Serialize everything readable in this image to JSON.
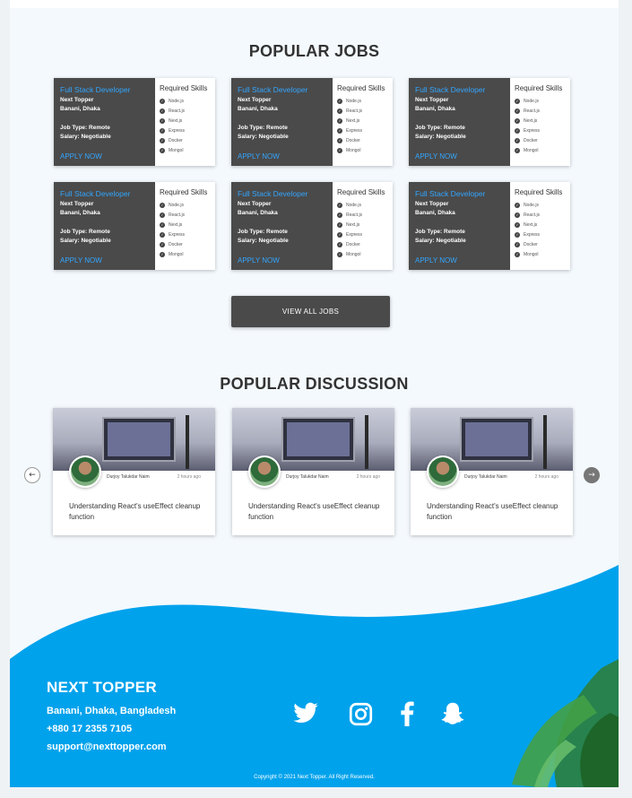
{
  "sections": {
    "jobs_title": "POPULAR JOBS",
    "discussion_title": "POPULAR DISCUSSION"
  },
  "jobs": [
    {
      "title": "Full Stack Developer",
      "company": "Next Topper",
      "location": "Banani, Dhaka",
      "type": "Job Type: Remote",
      "salary": "Salary: Negotiable",
      "apply": "APPLY NOW",
      "skills_title": "Required Skills",
      "skills": [
        "Node.js",
        "React.js",
        "Next.js",
        "Express",
        "Docker",
        "MongoI"
      ]
    },
    {
      "title": "Full Stack Developer",
      "company": "Next Topper",
      "location": "Banani, Dhaka",
      "type": "Job Type: Remote",
      "salary": "Salary: Negotiable",
      "apply": "APPLY NOW",
      "skills_title": "Required Skills",
      "skills": [
        "Node.js",
        "React.js",
        "Next.js",
        "Express",
        "Docker",
        "MongoI"
      ]
    },
    {
      "title": "Full Stack Developer",
      "company": "Next Topper",
      "location": "Banani, Dhaka",
      "type": "Job Type: Remote",
      "salary": "Salary: Negotiable",
      "apply": "APPLY NOW",
      "skills_title": "Required Skills",
      "skills": [
        "Node.js",
        "React.js",
        "Next.js",
        "Express",
        "Docker",
        "MongoI"
      ]
    },
    {
      "title": "Full Stack Developer",
      "company": "Next Topper",
      "location": "Banani, Dhaka",
      "type": "Job Type: Remote",
      "salary": "Salary: Negotiable",
      "apply": "APPLY NOW",
      "skills_title": "Required Skills",
      "skills": [
        "Node.js",
        "React.js",
        "Next.js",
        "Express",
        "Docker",
        "MongoI"
      ]
    },
    {
      "title": "Full Stack Developer",
      "company": "Next Topper",
      "location": "Banani, Dhaka",
      "type": "Job Type: Remote",
      "salary": "Salary: Negotiable",
      "apply": "APPLY NOW",
      "skills_title": "Required Skills",
      "skills": [
        "Node.js",
        "React.js",
        "Next.js",
        "Express",
        "Docker",
        "MongoI"
      ]
    },
    {
      "title": "Full Stack Developer",
      "company": "Next Topper",
      "location": "Banani, Dhaka",
      "type": "Job Type: Remote",
      "salary": "Salary: Negotiable",
      "apply": "APPLY NOW",
      "skills_title": "Required Skills",
      "skills": [
        "Node.js",
        "React.js",
        "Next.js",
        "Express",
        "Docker",
        "MongoI"
      ]
    }
  ],
  "view_all_label": "VIEW ALL JOBS",
  "discussions": [
    {
      "author": "Durjoy Talukdar Naim",
      "time": "2 hours ago",
      "title": "Understanding React's useEffect cleanup function"
    },
    {
      "author": "Durjoy Talukdar Naim",
      "time": "2 hours ago",
      "title": "Understanding React's useEffect cleanup function"
    },
    {
      "author": "Durjoy Talukdar Naim",
      "time": "2 hours ago",
      "title": "Understanding React's useEffect cleanup function"
    }
  ],
  "nav": {
    "prev_icon": "arrow-left-icon",
    "next_icon": "arrow-right-icon"
  },
  "footer": {
    "brand": "NEXT TOPPER",
    "address": "Banani, Dhaka, Bangladesh",
    "phone": "+880 17 2355 7105",
    "email": "support@nexttopper.com",
    "copyright": "Copyright © 2021 Next Topper. All Right Reserved.",
    "social": [
      "twitter-icon",
      "instagram-icon",
      "facebook-icon",
      "snapchat-icon"
    ],
    "bg_color": "#00a2ec"
  },
  "colors": {
    "accent": "#33a6ff",
    "card_dark": "#4a4a4a"
  }
}
